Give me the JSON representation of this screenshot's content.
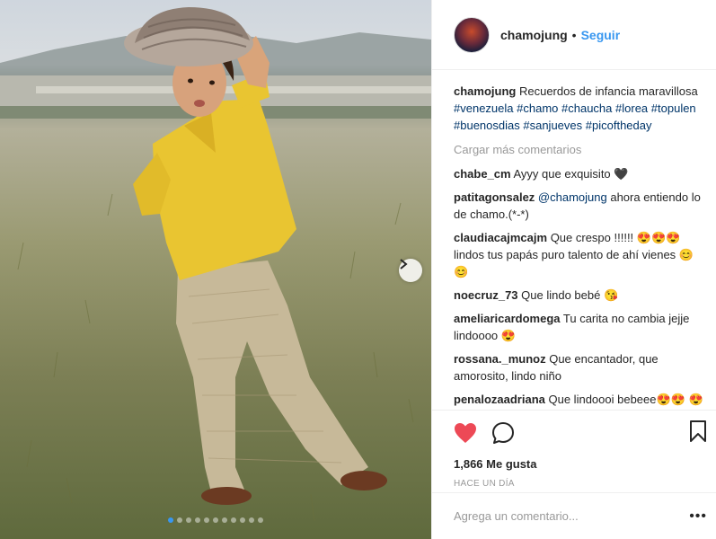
{
  "post": {
    "username": "chamojung",
    "separator": "•",
    "follow_label": "Seguir",
    "caption": {
      "user": "chamojung",
      "text": "Recuerdos de infancia maravillosa",
      "tags": [
        "#venezuela",
        "#chamo",
        "#chaucha",
        "#lorea",
        "#topulen",
        "#buenosdias",
        "#sanjueves",
        "#picoftheday"
      ]
    },
    "load_more_label": "Cargar más comentarios",
    "comments": [
      {
        "user": "chabe_cm",
        "text": "Ayyy que exquisito 🖤"
      },
      {
        "user": "patitagonsalez",
        "mention": "@chamojung",
        "text": "ahora entiendo lo de chamo.(*-*)"
      },
      {
        "user": "claudiacajmcajm",
        "text": "Que crespo !!!!!! 😍😍😍 lindos tus papás puro talento de ahí vienes 😊😊"
      },
      {
        "user": "noecruz_73",
        "text": "Que lindo bebé 😘"
      },
      {
        "user": "ameliaricardomega",
        "text": "Tu carita no cambia jejje lindoooo 😍"
      },
      {
        "user": "rossana._munoz",
        "text": "Que encantador, que amorosito, lindo niño"
      },
      {
        "user": "penalozaadriana",
        "text": "Que lindoooi bebeee😍😍 😍😍😍😍"
      }
    ],
    "likes": "1,866 Me gusta",
    "time": "HACE UN DÍA",
    "comment_placeholder": "Agrega un comentario...",
    "more_label": "•••",
    "carousel": {
      "count": 11,
      "active_index": 0
    },
    "colors": {
      "link": "#3897f0",
      "tag": "#003569",
      "heart": "#ed4956"
    },
    "icons": [
      "chevron-right-icon",
      "heart-icon",
      "comment-icon",
      "bookmark-icon",
      "more-icon"
    ]
  }
}
